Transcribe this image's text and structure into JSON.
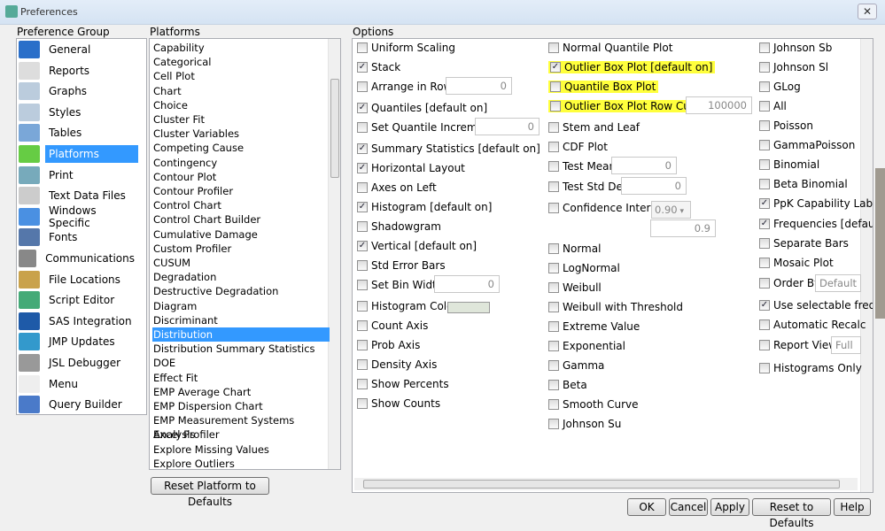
{
  "window": {
    "title": "Preferences",
    "close": "✕"
  },
  "preference_group": {
    "label": "Preference Group",
    "items": [
      "General",
      "Reports",
      "Graphs",
      "Styles",
      "Tables",
      "Platforms",
      "Print",
      "Text Data Files",
      "Windows Specific",
      "Fonts",
      "Communications",
      "File Locations",
      "Script Editor",
      "SAS Integration",
      "JMP Updates",
      "JSL Debugger",
      "Menu",
      "Query Builder"
    ],
    "selected": "Platforms"
  },
  "platforms": {
    "label": "Platforms",
    "items": [
      "Capability",
      "Categorical",
      "Cell Plot",
      "Chart",
      "Choice",
      "Cluster Fit",
      "Cluster Variables",
      "Competing Cause",
      "Contingency",
      "Contour Plot",
      "Contour Profiler",
      "Control Chart",
      "Control Chart Builder",
      "Cumulative Damage",
      "Custom Profiler",
      "CUSUM",
      "Degradation",
      "Destructive Degradation",
      "Diagram",
      "Discriminant",
      "Distribution",
      "Distribution Summary Statistics",
      "DOE",
      "Effect Fit",
      "EMP Average Chart",
      "EMP Dispersion Chart",
      "EMP Measurement Systems Analysis",
      "Excel Profiler",
      "Explore Missing Values",
      "Explore Outliers"
    ],
    "selected": "Distribution",
    "reset_button": "Reset Platform to Defaults"
  },
  "options": {
    "label": "Options",
    "col1": [
      {
        "label": "Uniform Scaling",
        "checked": false
      },
      {
        "label": "Stack",
        "checked": true
      },
      {
        "label": "Arrange in Rows",
        "checked": false,
        "value": "0"
      },
      {
        "label": "Quantiles [default on]",
        "checked": true
      },
      {
        "label": "Set Quantile Increment",
        "checked": false,
        "value": "0"
      },
      {
        "label": "Summary Statistics [default on]",
        "checked": true
      },
      {
        "label": "Horizontal Layout",
        "checked": true
      },
      {
        "label": "Axes on Left",
        "checked": false
      },
      {
        "label": "Histogram [default on]",
        "checked": true
      },
      {
        "label": "Shadowgram",
        "checked": false
      },
      {
        "label": "Vertical [default on]",
        "checked": true
      },
      {
        "label": "Std Error Bars",
        "checked": false
      },
      {
        "label": "Set Bin Width",
        "checked": false,
        "value": "0"
      },
      {
        "label": "Histogram Color",
        "checked": false,
        "color": "#dfe6da"
      },
      {
        "label": "Count Axis",
        "checked": false
      },
      {
        "label": "Prob Axis",
        "checked": false
      },
      {
        "label": "Density Axis",
        "checked": false
      },
      {
        "label": "Show Percents",
        "checked": false
      },
      {
        "label": "Show Counts",
        "checked": false
      }
    ],
    "col2": [
      {
        "label": "Normal Quantile Plot",
        "checked": false
      },
      {
        "label": "Outlier Box Plot [default on]",
        "checked": true,
        "highlight": true
      },
      {
        "label": "Quantile Box Plot",
        "checked": false,
        "highlight": true
      },
      {
        "label": "Outlier Box Plot Row Cutoff",
        "checked": false,
        "highlight": true,
        "value": "100000"
      },
      {
        "label": "Stem and Leaf",
        "checked": false
      },
      {
        "label": "CDF Plot",
        "checked": false
      },
      {
        "label": "Test Mean",
        "checked": false,
        "value": "0"
      },
      {
        "label": "Test Std Dev",
        "checked": false,
        "value": "0"
      },
      {
        "label": "Confidence Interval",
        "checked": false,
        "select": "0.90",
        "value": "0.9"
      },
      {
        "label": "Normal",
        "checked": false
      },
      {
        "label": "LogNormal",
        "checked": false
      },
      {
        "label": "Weibull",
        "checked": false
      },
      {
        "label": "Weibull with Threshold",
        "checked": false
      },
      {
        "label": "Extreme Value",
        "checked": false
      },
      {
        "label": "Exponential",
        "checked": false
      },
      {
        "label": "Gamma",
        "checked": false
      },
      {
        "label": "Beta",
        "checked": false
      },
      {
        "label": "Smooth Curve",
        "checked": false
      },
      {
        "label": "Johnson Su",
        "checked": false
      }
    ],
    "col3": [
      {
        "label": "Johnson Sb",
        "checked": false
      },
      {
        "label": "Johnson Sl",
        "checked": false
      },
      {
        "label": "GLog",
        "checked": false
      },
      {
        "label": "All",
        "checked": false
      },
      {
        "label": "Poisson",
        "checked": false
      },
      {
        "label": "GammaPoisson",
        "checked": false
      },
      {
        "label": "Binomial",
        "checked": false
      },
      {
        "label": "Beta Binomial",
        "checked": false
      },
      {
        "label": "PpK Capability Labe",
        "checked": true
      },
      {
        "label": "Frequencies [default",
        "checked": true
      },
      {
        "label": "Separate Bars",
        "checked": false
      },
      {
        "label": "Mosaic Plot",
        "checked": false
      },
      {
        "label": "Order By",
        "checked": false,
        "select": "Default"
      },
      {
        "label": "Use selectable frequ",
        "checked": true
      },
      {
        "label": "Automatic Recalc",
        "checked": false
      },
      {
        "label": "Report View",
        "checked": false,
        "select": "Full"
      },
      {
        "label": "Histograms Only",
        "checked": false
      }
    ]
  },
  "buttons": {
    "ok": "OK",
    "cancel": "Cancel",
    "apply": "Apply",
    "reset": "Reset to Defaults",
    "help": "Help"
  },
  "colors": {
    "selection": "#3399ff",
    "highlight": "#ffff3c"
  }
}
